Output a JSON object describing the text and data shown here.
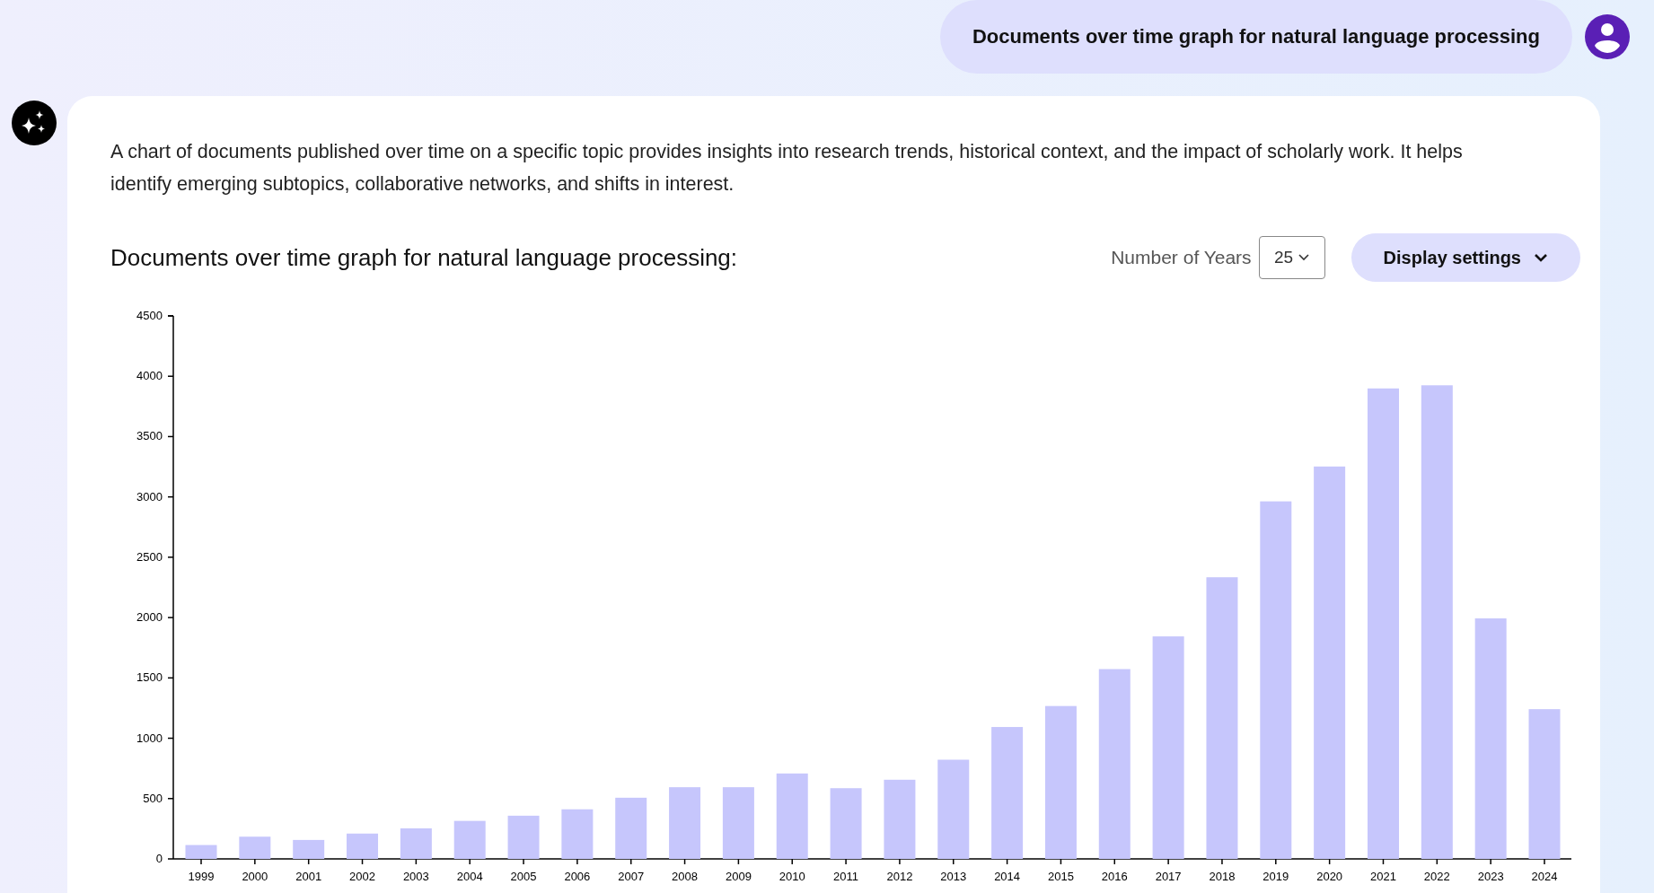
{
  "query": {
    "text": "Documents over time graph for natural language processing"
  },
  "answer": {
    "description": "A chart of documents published over time on a specific topic provides insights into research trends, historical context, and the impact of scholarly work. It helps identify emerging subtopics, collaborative networks, and shifts in interest.",
    "chart_heading": "Documents over time graph for natural language processing:",
    "years_label": "Number of Years",
    "years_value": "25",
    "display_settings": "Display settings",
    "chart_data": {
      "type": "bar",
      "categories": [
        "1999",
        "2000",
        "2001",
        "2002",
        "2003",
        "2004",
        "2005",
        "2006",
        "2007",
        "2008",
        "2009",
        "2010",
        "2011",
        "2012",
        "2013",
        "2014",
        "2015",
        "2016",
        "2017",
        "2018",
        "2019",
        "2020",
        "2021",
        "2022",
        "2023",
        "2024"
      ],
      "series": [
        {
          "color": "#c6c6fc",
          "values": [
            115,
            184,
            157,
            210,
            253,
            315,
            358,
            411,
            507,
            594,
            594,
            708,
            586,
            656,
            822,
            1093,
            1267,
            1573,
            1844,
            2334,
            2963,
            3252,
            3899,
            3925,
            1993,
            1241
          ]
        }
      ],
      "ylim": [
        0,
        4500
      ],
      "yticks": [
        0,
        500,
        1000,
        1500,
        2000,
        2500,
        3000,
        3500,
        4000,
        4500
      ]
    }
  }
}
